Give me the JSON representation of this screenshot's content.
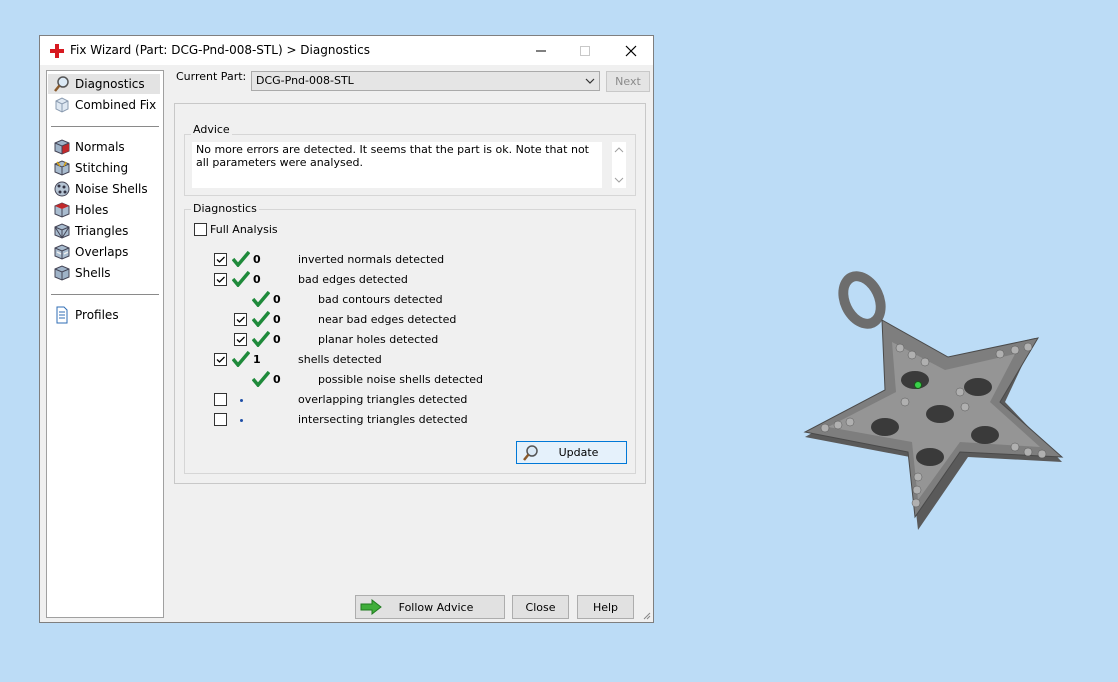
{
  "window": {
    "title": "Fix Wizard (Part: DCG-Pnd-008-STL) > Diagnostics"
  },
  "sidebar": {
    "items": [
      {
        "label": "Diagnostics",
        "icon": "magnifier-icon"
      },
      {
        "label": "Combined Fix",
        "icon": "combined-fix-icon"
      },
      {
        "label": "Normals",
        "icon": "normals-cube-icon"
      },
      {
        "label": "Stitching",
        "icon": "stitching-cube-icon"
      },
      {
        "label": "Noise Shells",
        "icon": "noise-shells-icon"
      },
      {
        "label": "Holes",
        "icon": "holes-cube-icon"
      },
      {
        "label": "Triangles",
        "icon": "triangles-cube-icon"
      },
      {
        "label": "Overlaps",
        "icon": "overlaps-cube-icon"
      },
      {
        "label": "Shells",
        "icon": "shells-cube-icon"
      },
      {
        "label": "Profiles",
        "icon": "document-icon"
      }
    ]
  },
  "current_part": {
    "label": "Current Part:",
    "value": "DCG-Pnd-008-STL",
    "next_label": "Next"
  },
  "advice": {
    "title": "Advice",
    "text": "No more errors are detected. It seems that the part is ok. Note that not all parameters were analysed."
  },
  "diagnostics": {
    "title": "Diagnostics",
    "full_analysis_label": "Full Analysis",
    "rows": [
      {
        "checkbox": true,
        "checked": true,
        "status": "ok",
        "value": "0",
        "label": "inverted normals detected"
      },
      {
        "checkbox": true,
        "checked": true,
        "status": "ok",
        "value": "0",
        "label": "bad edges detected"
      },
      {
        "checkbox": false,
        "checked": false,
        "status": "ok",
        "value": "0",
        "label": "bad contours detected"
      },
      {
        "checkbox": true,
        "checked": true,
        "status": "ok",
        "value": "0",
        "label": "near bad edges detected"
      },
      {
        "checkbox": true,
        "checked": true,
        "status": "ok",
        "value": "0",
        "label": "planar holes detected"
      },
      {
        "checkbox": true,
        "checked": true,
        "status": "ok",
        "value": "1",
        "label": "shells detected"
      },
      {
        "checkbox": false,
        "checked": false,
        "status": "ok",
        "value": "0",
        "label": "possible noise shells detected"
      },
      {
        "checkbox": true,
        "checked": false,
        "status": "pending",
        "value": "",
        "label": "overlapping triangles detected"
      },
      {
        "checkbox": true,
        "checked": false,
        "status": "pending",
        "value": "",
        "label": "intersecting triangles detected"
      }
    ],
    "update_label": "Update"
  },
  "footer": {
    "follow_advice_label": "Follow Advice",
    "close_label": "Close",
    "help_label": "Help"
  },
  "colors": {
    "desktop": "#bcdcf6",
    "check_green": "#1f8a3b",
    "accent": "#0078d7"
  }
}
